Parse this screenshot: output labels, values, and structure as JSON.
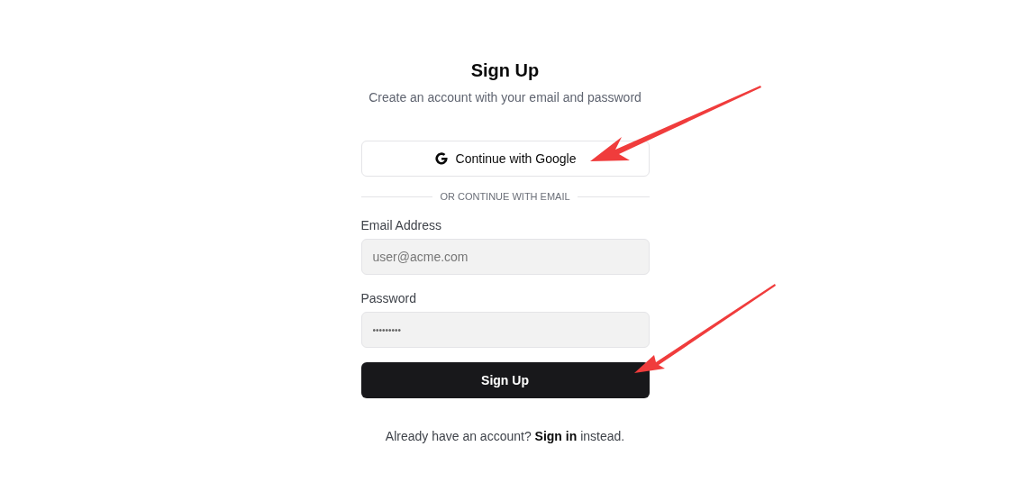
{
  "title": "Sign Up",
  "subtitle": "Create an account with your email and password",
  "google_button": {
    "label": "Continue with Google"
  },
  "divider": "OR CONTINUE WITH EMAIL",
  "fields": [
    {
      "label": "Email Address",
      "placeholder": "user@acme.com",
      "kind": "text"
    },
    {
      "label": "Password",
      "value": "•••••••••",
      "kind": "password"
    }
  ],
  "submit_button": {
    "label": "Sign Up"
  },
  "footer": {
    "before": "Already have an account?",
    "link": "Sign in",
    "after": "instead."
  }
}
